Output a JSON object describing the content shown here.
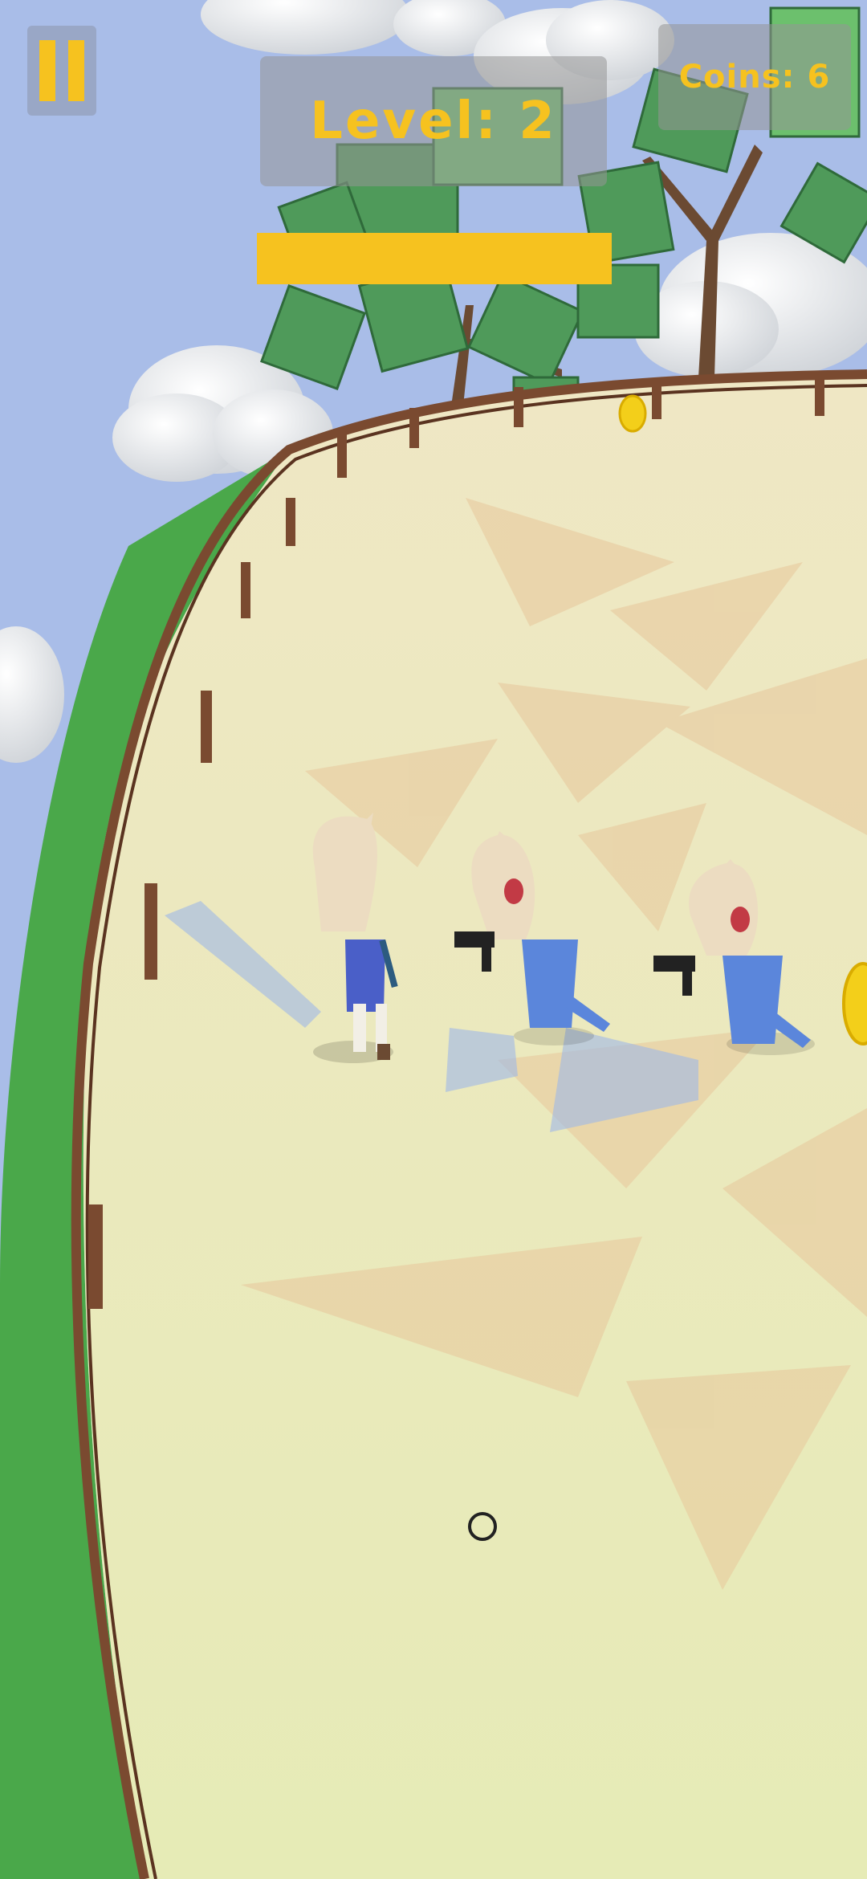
{
  "hud": {
    "pause_icon": "pause-icon",
    "level_text": "Level: 2",
    "coins_text": "Coins: 6",
    "progress_fraction": 1.0
  },
  "colors": {
    "accent": "#f6c21f",
    "sky": "#a9bde8",
    "ground": "#e9e4b6",
    "grass": "#4aa84a",
    "fence": "#7a4a30"
  },
  "scene": {
    "touch_indicator_icon": "ring-icon",
    "characters": [
      "player-character",
      "enemy-character",
      "enemy-character"
    ]
  }
}
